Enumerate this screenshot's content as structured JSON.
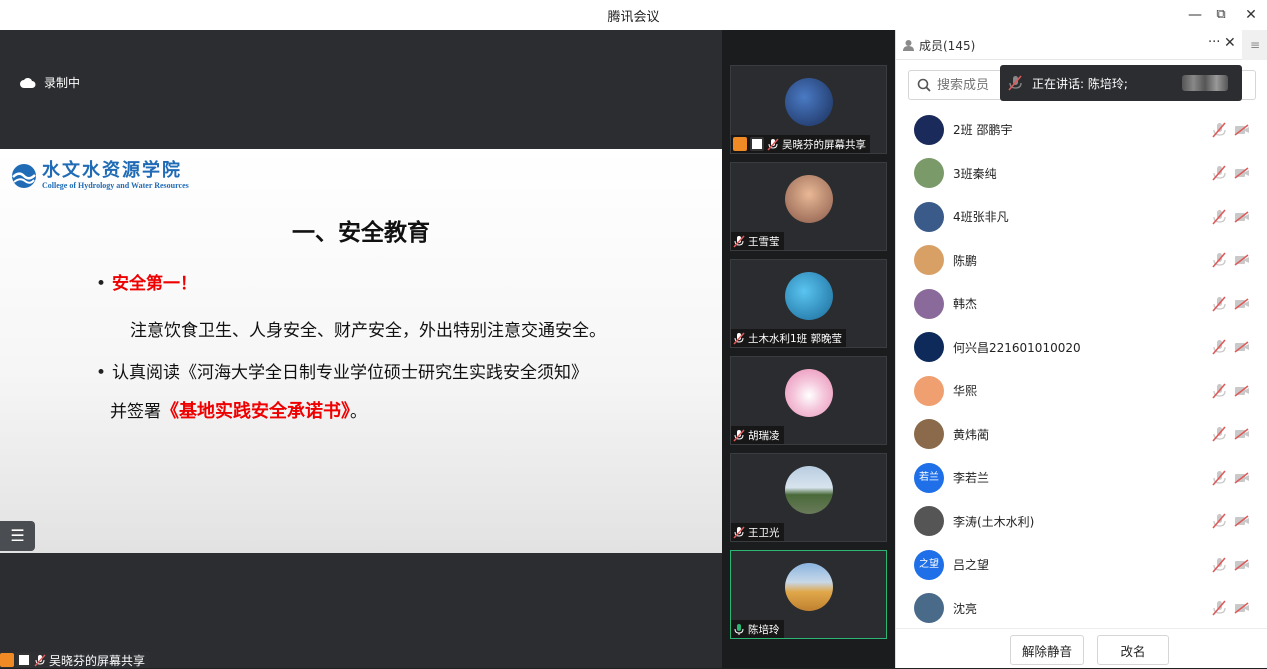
{
  "window": {
    "title": "腾讯会议",
    "minimize": "—",
    "restore": "⧉",
    "close": "✕"
  },
  "recording": {
    "label": "录制中"
  },
  "slide": {
    "logo_cn": "水文水资源学院",
    "logo_en": "College of Hydrology and Water Resources",
    "heading": "一、安全教育",
    "bullet1": "安全第一！",
    "para1": "注意饮食卫生、人身安全、财产安全，外出特别注意交通安全。",
    "bullet2": "认真阅读《河海大学全日制专业学位硕士研究生实践安全须知》",
    "para2_prefix": "并签署",
    "para2_red": "《基地实践安全承诺书》",
    "para2_suffix": "。",
    "bullet_char": "•"
  },
  "share_bar": {
    "label": "吴晓芬的屏幕共享"
  },
  "video_tiles": [
    {
      "name": "吴晓芬的屏幕共享",
      "avatar_color": "#2a4e8c",
      "share": true,
      "active": false
    },
    {
      "name": "王雪莹",
      "avatar_color": "#c98a6a",
      "share": false,
      "active": false
    },
    {
      "name": "土木水利1班 郭晚莹",
      "avatar_color": "#2e8fc4",
      "share": false,
      "active": false
    },
    {
      "name": "胡瑞凌",
      "avatar_color": "#f2a8c8",
      "share": false,
      "active": false
    },
    {
      "name": "王卫光",
      "avatar_color": "#6d8aa8",
      "share": false,
      "active": false
    },
    {
      "name": "陈培玲",
      "avatar_color": "#e0b25a",
      "share": false,
      "active": true
    }
  ],
  "panel": {
    "title": "成员(145)",
    "more": "···",
    "close": "✕",
    "list_icon": "≡",
    "search_placeholder": "搜索成员",
    "speaking": "正在讲话: 陈培玲;",
    "members": [
      {
        "name": "2班   邵鹏宇",
        "avatar_color": "#1a2a5a",
        "avatar_text": ""
      },
      {
        "name": "3班秦纯",
        "avatar_color": "#7a9a6a",
        "avatar_text": ""
      },
      {
        "name": "4班张非凡",
        "avatar_color": "#3a5a8a",
        "avatar_text": ""
      },
      {
        "name": "陈鹏",
        "avatar_color": "#d9a066",
        "avatar_text": ""
      },
      {
        "name": "韩杰",
        "avatar_color": "#8a6a9a",
        "avatar_text": ""
      },
      {
        "name": "何兴昌221601010020",
        "avatar_color": "#0d2a5a",
        "avatar_text": ""
      },
      {
        "name": "华熙",
        "avatar_color": "#f0a070",
        "avatar_text": ""
      },
      {
        "name": "黄炜蔺",
        "avatar_color": "#8a6a4a",
        "avatar_text": ""
      },
      {
        "name": "李若兰",
        "avatar_color": "#1e6fe8",
        "avatar_text": "若兰"
      },
      {
        "name": "李涛(土木水利)",
        "avatar_color": "#555555",
        "avatar_text": ""
      },
      {
        "name": "吕之望",
        "avatar_color": "#1e6fe8",
        "avatar_text": "之望"
      },
      {
        "name": "沈亮",
        "avatar_color": "#4a6a8a",
        "avatar_text": ""
      }
    ],
    "unmute_all": "解除静音",
    "rename": "改名"
  },
  "colors": {
    "accent_green": "#2bb673",
    "muted_red": "#e05a5a",
    "brand_blue": "#1f6bb5"
  }
}
